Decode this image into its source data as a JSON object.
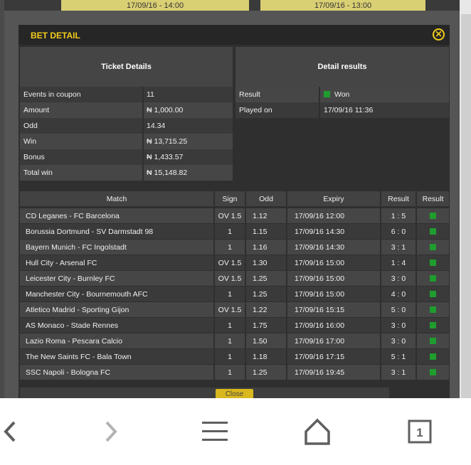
{
  "background": {
    "date_1": "17/09/16 - 14:00",
    "date_2": "17/09/16 - 13:00"
  },
  "modal": {
    "title": "BET DETAIL",
    "close_icon": "close-circle-icon",
    "close_button_label": "Close"
  },
  "ticket": {
    "heading": "Ticket Details",
    "rows": [
      {
        "label": "Events in coupon",
        "value": "11"
      },
      {
        "label": "Amount",
        "value": "₦ 1,000.00"
      },
      {
        "label": "Odd",
        "value": "14.34"
      },
      {
        "label": "Win",
        "value": "₦ 13,715.25"
      },
      {
        "label": "Bonus",
        "value": "₦ 1,433.57"
      },
      {
        "label": "Total win",
        "value": "₦ 15,148.82"
      }
    ]
  },
  "results": {
    "heading": "Detail results",
    "rows": [
      {
        "label": "Result",
        "value": "Won"
      },
      {
        "label": "Played on",
        "value": "17/09/16 11:36"
      }
    ]
  },
  "matches": {
    "headers": {
      "match": "Match",
      "sign": "Sign",
      "odd": "Odd",
      "expiry": "Expiry",
      "result": "Result",
      "status": "Result"
    },
    "rows": [
      {
        "match": "CD Leganes - FC Barcelona",
        "sign": "OV 1.5",
        "odd": "1.12",
        "expiry": "17/09/16 12:00",
        "result": "1 : 5"
      },
      {
        "match": "Borussia Dortmund - SV Darmstadt 98",
        "sign": "1",
        "odd": "1.15",
        "expiry": "17/09/16 14:30",
        "result": "6 : 0"
      },
      {
        "match": "Bayern Munich - FC Ingolstadt",
        "sign": "1",
        "odd": "1.16",
        "expiry": "17/09/16 14:30",
        "result": "3 : 1"
      },
      {
        "match": "Hull City - Arsenal FC",
        "sign": "OV 1.5",
        "odd": "1.30",
        "expiry": "17/09/16 15:00",
        "result": "1 : 4"
      },
      {
        "match": "Leicester City - Burnley FC",
        "sign": "OV 1.5",
        "odd": "1.25",
        "expiry": "17/09/16 15:00",
        "result": "3 : 0"
      },
      {
        "match": "Manchester City - Bournemouth AFC",
        "sign": "1",
        "odd": "1.25",
        "expiry": "17/09/16 15:00",
        "result": "4 : 0"
      },
      {
        "match": "Atletico Madrid - Sporting Gijon",
        "sign": "OV 1.5",
        "odd": "1.22",
        "expiry": "17/09/16 15:15",
        "result": "5 : 0"
      },
      {
        "match": "AS Monaco - Stade Rennes",
        "sign": "1",
        "odd": "1.75",
        "expiry": "17/09/16 16:00",
        "result": "3 : 0"
      },
      {
        "match": "Lazio Roma - Pescara Calcio",
        "sign": "1",
        "odd": "1.50",
        "expiry": "17/09/16 17:00",
        "result": "3 : 0"
      },
      {
        "match": "The New Saints FC - Bala Town",
        "sign": "1",
        "odd": "1.18",
        "expiry": "17/09/16 17:15",
        "result": "5 : 1"
      },
      {
        "match": "SSC Napoli - Bologna FC",
        "sign": "1",
        "odd": "1.25",
        "expiry": "17/09/16 19:45",
        "result": "3 : 1"
      }
    ]
  },
  "nav": {
    "back_icon": "chevron-left-icon",
    "forward_icon": "chevron-right-icon",
    "menu_icon": "hamburger-menu-icon",
    "home_icon": "home-icon",
    "tabs_icon": "tabs-count-icon",
    "tab_count": "1"
  },
  "colors": {
    "accent_yellow": "#f2cc1c",
    "won_green": "#1f9d2e",
    "modal_bg": "#2f2f2f"
  }
}
